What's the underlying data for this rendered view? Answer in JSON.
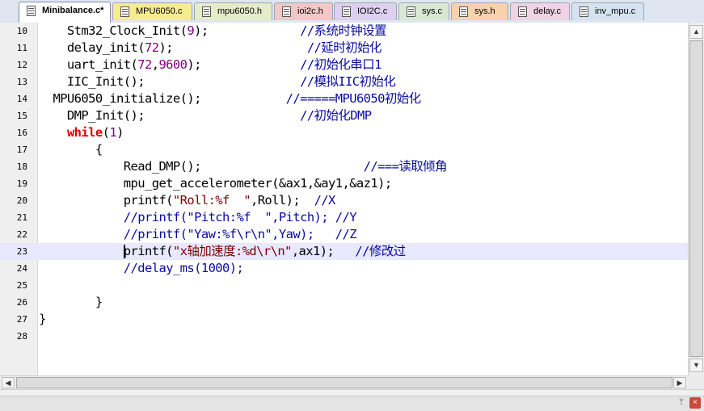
{
  "tabs": [
    {
      "label": "Minibalance.c*",
      "color": "#ffffff",
      "active": true,
      "icon": "file-c-icon"
    },
    {
      "label": "MPU6050.c",
      "color": "#f6eb8f",
      "active": false,
      "icon": "file-c-icon"
    },
    {
      "label": "mpu6050.h",
      "color": "#e6ecc8",
      "active": false,
      "icon": "file-h-icon"
    },
    {
      "label": "ioi2c.h",
      "color": "#f3c7c7",
      "active": false,
      "icon": "file-h-icon"
    },
    {
      "label": "IOI2C.c",
      "color": "#dcd0ee",
      "active": false,
      "icon": "file-c-icon"
    },
    {
      "label": "sys.c",
      "color": "#d9e7d5",
      "active": false,
      "icon": "file-c-icon"
    },
    {
      "label": "sys.h",
      "color": "#f7d2ad",
      "active": false,
      "icon": "file-h-icon"
    },
    {
      "label": "delay.c",
      "color": "#f0d3e4",
      "active": false,
      "icon": "file-c-icon"
    },
    {
      "label": "inv_mpu.c",
      "color": "#d5e3f0",
      "active": false,
      "icon": "file-c-icon"
    }
  ],
  "editor": {
    "current_line": "23",
    "lines": [
      {
        "num": "10",
        "parts": [
          {
            "t": "    Stm32_Clock_Init(",
            "c": ""
          },
          {
            "t": "9",
            "c": "num"
          },
          {
            "t": ");             ",
            "c": ""
          },
          {
            "t": "//系统时钟设置",
            "c": "cmt"
          }
        ]
      },
      {
        "num": "11",
        "parts": [
          {
            "t": "    delay_init(",
            "c": ""
          },
          {
            "t": "72",
            "c": "num"
          },
          {
            "t": ");                   ",
            "c": ""
          },
          {
            "t": "//延时初始化",
            "c": "cmt"
          }
        ]
      },
      {
        "num": "12",
        "parts": [
          {
            "t": "    uart_init(",
            "c": ""
          },
          {
            "t": "72",
            "c": "num"
          },
          {
            "t": ",",
            "c": ""
          },
          {
            "t": "9600",
            "c": "num"
          },
          {
            "t": ");              ",
            "c": ""
          },
          {
            "t": "//初始化串口1",
            "c": "cmt"
          }
        ]
      },
      {
        "num": "13",
        "parts": [
          {
            "t": "    IIC_Init();                      ",
            "c": ""
          },
          {
            "t": "//模拟IIC初始化",
            "c": "cmt"
          }
        ]
      },
      {
        "num": "14",
        "parts": [
          {
            "t": "  MPU6050_initialize();            ",
            "c": ""
          },
          {
            "t": "//=====MPU6050初始化",
            "c": "cmt"
          }
        ]
      },
      {
        "num": "15",
        "parts": [
          {
            "t": "    DMP_Init();                      ",
            "c": ""
          },
          {
            "t": "//初始化DMP",
            "c": "cmt"
          }
        ]
      },
      {
        "num": "16",
        "parts": [
          {
            "t": "    ",
            "c": ""
          },
          {
            "t": "while",
            "c": "kw"
          },
          {
            "t": "(",
            "c": ""
          },
          {
            "t": "1",
            "c": "num"
          },
          {
            "t": ")",
            "c": ""
          }
        ]
      },
      {
        "num": "17",
        "parts": [
          {
            "t": "        {",
            "c": ""
          }
        ]
      },
      {
        "num": "18",
        "parts": [
          {
            "t": "            Read_DMP();                       ",
            "c": ""
          },
          {
            "t": "//===读取倾角",
            "c": "cmt"
          }
        ]
      },
      {
        "num": "19",
        "parts": [
          {
            "t": "            mpu_get_accelerometer(&ax1,&ay1,&az1);",
            "c": ""
          }
        ]
      },
      {
        "num": "20",
        "parts": [
          {
            "t": "            printf(",
            "c": ""
          },
          {
            "t": "\"Roll:%f  \"",
            "c": "str"
          },
          {
            "t": ",Roll);  ",
            "c": ""
          },
          {
            "t": "//X",
            "c": "cmt"
          }
        ]
      },
      {
        "num": "21",
        "parts": [
          {
            "t": "            ",
            "c": ""
          },
          {
            "t": "//printf(\"Pitch:%f  \",Pitch); //Y",
            "c": "cmt"
          }
        ]
      },
      {
        "num": "22",
        "parts": [
          {
            "t": "            ",
            "c": ""
          },
          {
            "t": "//printf(\"Yaw:%f\\r\\n\",Yaw);   //Z",
            "c": "cmt"
          }
        ]
      },
      {
        "num": "23",
        "parts": [
          {
            "t": "            printf(",
            "c": ""
          },
          {
            "t": "\"x轴加速度:%d\\r\\n\"",
            "c": "str"
          },
          {
            "t": ",ax1);   ",
            "c": ""
          },
          {
            "t": "//修改过",
            "c": "cmt"
          }
        ]
      },
      {
        "num": "24",
        "parts": [
          {
            "t": "            ",
            "c": ""
          },
          {
            "t": "//delay_ms(1000);",
            "c": "cmt"
          }
        ]
      },
      {
        "num": "25",
        "parts": [
          {
            "t": "",
            "c": ""
          }
        ]
      },
      {
        "num": "26",
        "parts": [
          {
            "t": "        }",
            "c": ""
          }
        ]
      },
      {
        "num": "27",
        "parts": [
          {
            "t": "}",
            "c": ""
          }
        ]
      },
      {
        "num": "28",
        "parts": [
          {
            "t": "",
            "c": ""
          }
        ]
      }
    ]
  },
  "scrollbars": {
    "up_arrow": "▲",
    "down_arrow": "▼",
    "left_arrow": "◀",
    "right_arrow": "▶"
  },
  "pane": {
    "pin_icon": "pin-icon",
    "pin_glyph": "ᛘ",
    "close_glyph": "×"
  }
}
